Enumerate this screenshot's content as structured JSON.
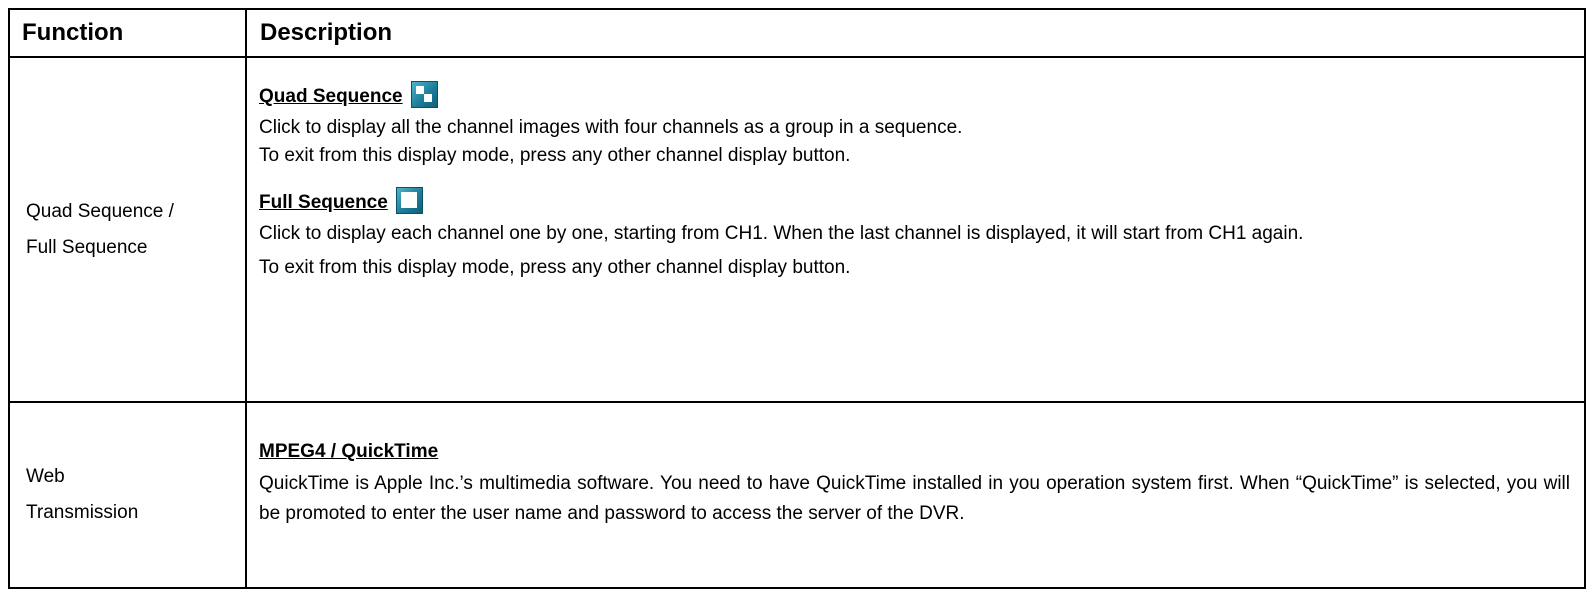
{
  "table": {
    "header": {
      "function": "Function",
      "description": "Description"
    },
    "rows": [
      {
        "function_lines": [
          "Quad Sequence /",
          "Full Sequence"
        ],
        "sections": [
          {
            "title": "Quad Sequence",
            "icon": "quad-sequence-icon",
            "lines": [
              "Click to display all the channel images with four channels as a group in a sequence.",
              "To exit from this display mode, press any other channel display button."
            ]
          },
          {
            "title": "Full Sequence",
            "icon": "full-sequence-icon",
            "lines": [
              "Click to display each channel one by one, starting from CH1. When the last channel is displayed, it will start from CH1 again.",
              "To exit from this display mode, press any other channel display button."
            ]
          }
        ]
      },
      {
        "function_lines": [
          "Web",
          "Transmission"
        ],
        "sections": [
          {
            "title": "MPEG4 / QuickTime",
            "lines": [
              "QuickTime is Apple Inc.’s multimedia software. You need to have QuickTime installed in you operation system first. When “QuickTime” is selected, you will be promoted to enter the user name and password to access the server of the DVR."
            ]
          }
        ]
      }
    ]
  }
}
